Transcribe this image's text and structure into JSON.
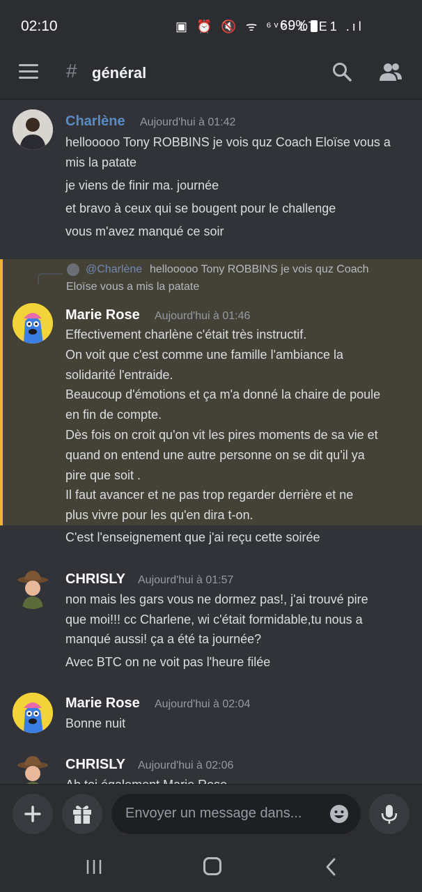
{
  "status_bar": {
    "time": "02:10",
    "icons_text": "▣ ⏰ 🔇 ᯤ ⁶ᵛᵒˡ LTE1 .ıl",
    "battery": "69%"
  },
  "header": {
    "hash": "#",
    "channel": "général",
    "icons": [
      "menu-icon",
      "search-icon",
      "members-icon"
    ]
  },
  "messages": [
    {
      "author": "Charlène",
      "author_color": "#5a8bc2",
      "timestamp": "Aujourd'hui à 01:42",
      "lines": [
        "hellooooo Tony ROBBINS  je vois quz Coach Eloïse vous a",
        "mis la patate",
        "je viens de finir ma. journée",
        "et bravo à ceux qui se bougent pour le challenge",
        "vous m'avez manqué ce soir"
      ]
    },
    {
      "reply_mention": "@Charlène",
      "reply_text_1": "hellooooo Tony ROBBINS  je vois quz Coach",
      "reply_text_2": "Eloïse vous a mis la patate",
      "author": "Marie Rose",
      "author_color": "#ffffff",
      "timestamp": "Aujourd'hui à 01:46",
      "lines": [
        "Effectivement charlène c'était très instructif.",
        "On voit que c'est comme une famille l'ambiance la",
        "solidarité l'entraide.",
        "Beaucoup d'émotions et ça m'a donné la chaire de poule",
        "en fin de compte.",
        "Dès fois on croit qu'on vit les pires moments de sa vie et",
        "quand on entend une autre personne on se dit qu'il ya",
        "pire que soit .",
        "Il faut avancer et ne pas trop regarder derrière et ne",
        "plus vivre pour les qu'en dira t-on."
      ],
      "followup": "C'est l'enseignement que j'ai reçu cette soirée"
    },
    {
      "author": "CHRISLY",
      "author_color": "#ffffff",
      "timestamp": "Aujourd'hui à 01:57",
      "lines": [
        "non mais les gars vous ne dormez pas!, j'ai trouvé pire",
        "que moi!!! cc Charlene, wi c'était formidable,tu nous a",
        "manqué aussi! ça a été ta journée?",
        "Avec BTC on ne voit pas l'heure filée"
      ]
    },
    {
      "author": "Marie Rose",
      "author_color": "#ffffff",
      "timestamp": "Aujourd'hui à 02:04",
      "lines": [
        "Bonne nuit"
      ]
    },
    {
      "author": "CHRISLY",
      "author_color": "#ffffff",
      "timestamp": "Aujourd'hui à 02:06",
      "lines": [
        "Ah toi également Marie Rose"
      ]
    }
  ],
  "composer": {
    "placeholder": "Envoyer un message dans..."
  },
  "colors": {
    "background": "#313338",
    "highlight": "#444137",
    "highlight_bar": "#f0b232",
    "mention": "#7289b0"
  }
}
